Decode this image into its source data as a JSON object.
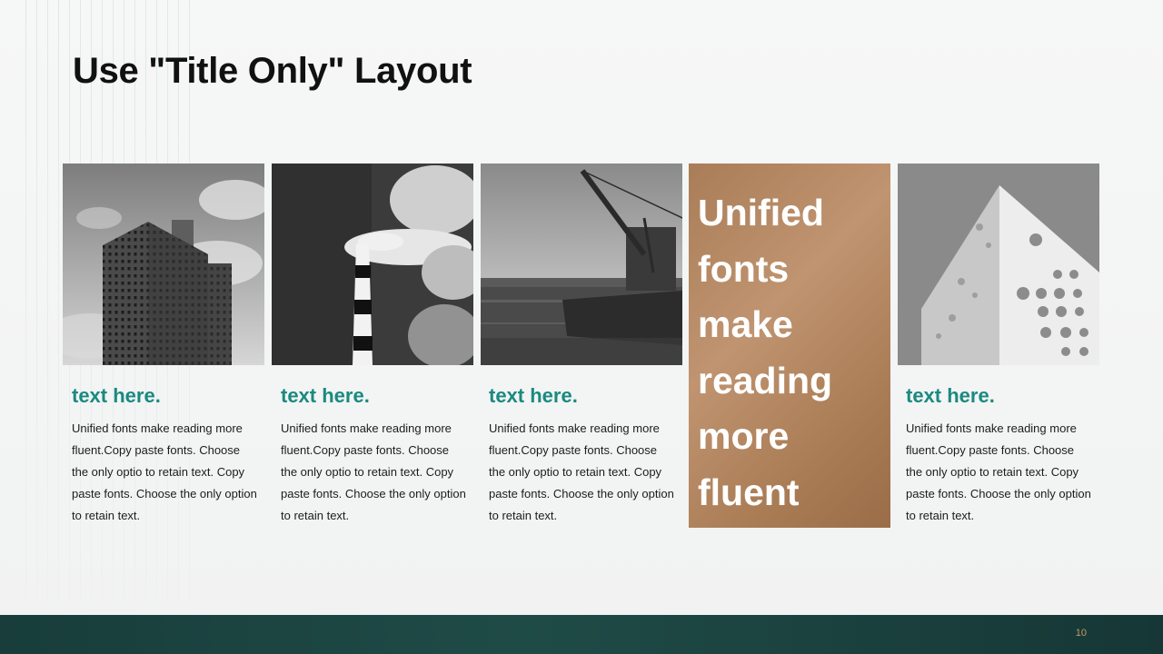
{
  "slide": {
    "title": "Use \"Title Only\" Layout",
    "page_number": "10"
  },
  "cards": [
    {
      "heading": "text here.",
      "body": "Unified  fonts make reading more fluent.Copy paste fonts. Choose the only optio to retain text. Copy paste  fonts. Choose the only option to retain text.",
      "image_icon": "highrise-building-photo"
    },
    {
      "heading": "text here.",
      "body": "Unified  fonts make reading more fluent.Copy paste fonts. Choose the only optio to retain text. Copy paste  fonts. Choose the only option to retain text.",
      "image_icon": "smokestack-photo"
    },
    {
      "heading": "text here.",
      "body": "Unified  fonts make reading more fluent.Copy paste fonts. Choose the only optio to retain text. Copy paste  fonts. Choose the only option to retain text.",
      "image_icon": "harbor-crane-photo"
    },
    {
      "heading": "text here.",
      "body": "Unified  fonts make reading more fluent.Copy paste fonts. Choose the only optio to retain text. Copy paste  fonts. Choose the only option to retain text.",
      "image_icon": "perforated-wall-photo"
    }
  ],
  "accent": {
    "text": "Unified fonts make reading more fluent",
    "color": "#b08660"
  },
  "colors": {
    "heading": "#1a8a80",
    "footer": "#1c4542",
    "page_number": "#c59a63"
  }
}
